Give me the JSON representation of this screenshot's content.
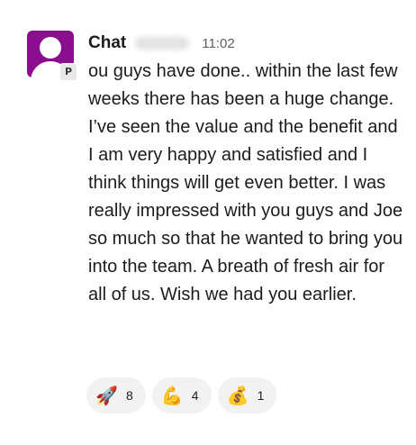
{
  "message": {
    "avatar_badge": "P",
    "sender_name": "Chat",
    "timestamp": "11:02",
    "text": "ou guys have done.. within the last few weeks there has been a huge change. I’ve seen the value and the benefit and I am very happy and satisfied and I think things will get even better. I was really impressed with you guys and Joe so much so that he wanted to bring you into the team. A breath of fresh air for all of us. Wish we had you earlier."
  },
  "reactions": [
    {
      "icon": "rocket-icon",
      "glyph": "🚀",
      "count": "8"
    },
    {
      "icon": "flexed-biceps-icon",
      "glyph": "💪",
      "count": "4"
    },
    {
      "icon": "money-bag-icon",
      "glyph": "💰",
      "count": "1"
    }
  ],
  "colors": {
    "avatar_bg": "#8a0f8f",
    "text": "#1d1c1d",
    "timestamp": "#616061",
    "reaction_bg": "#f2f2f2"
  }
}
